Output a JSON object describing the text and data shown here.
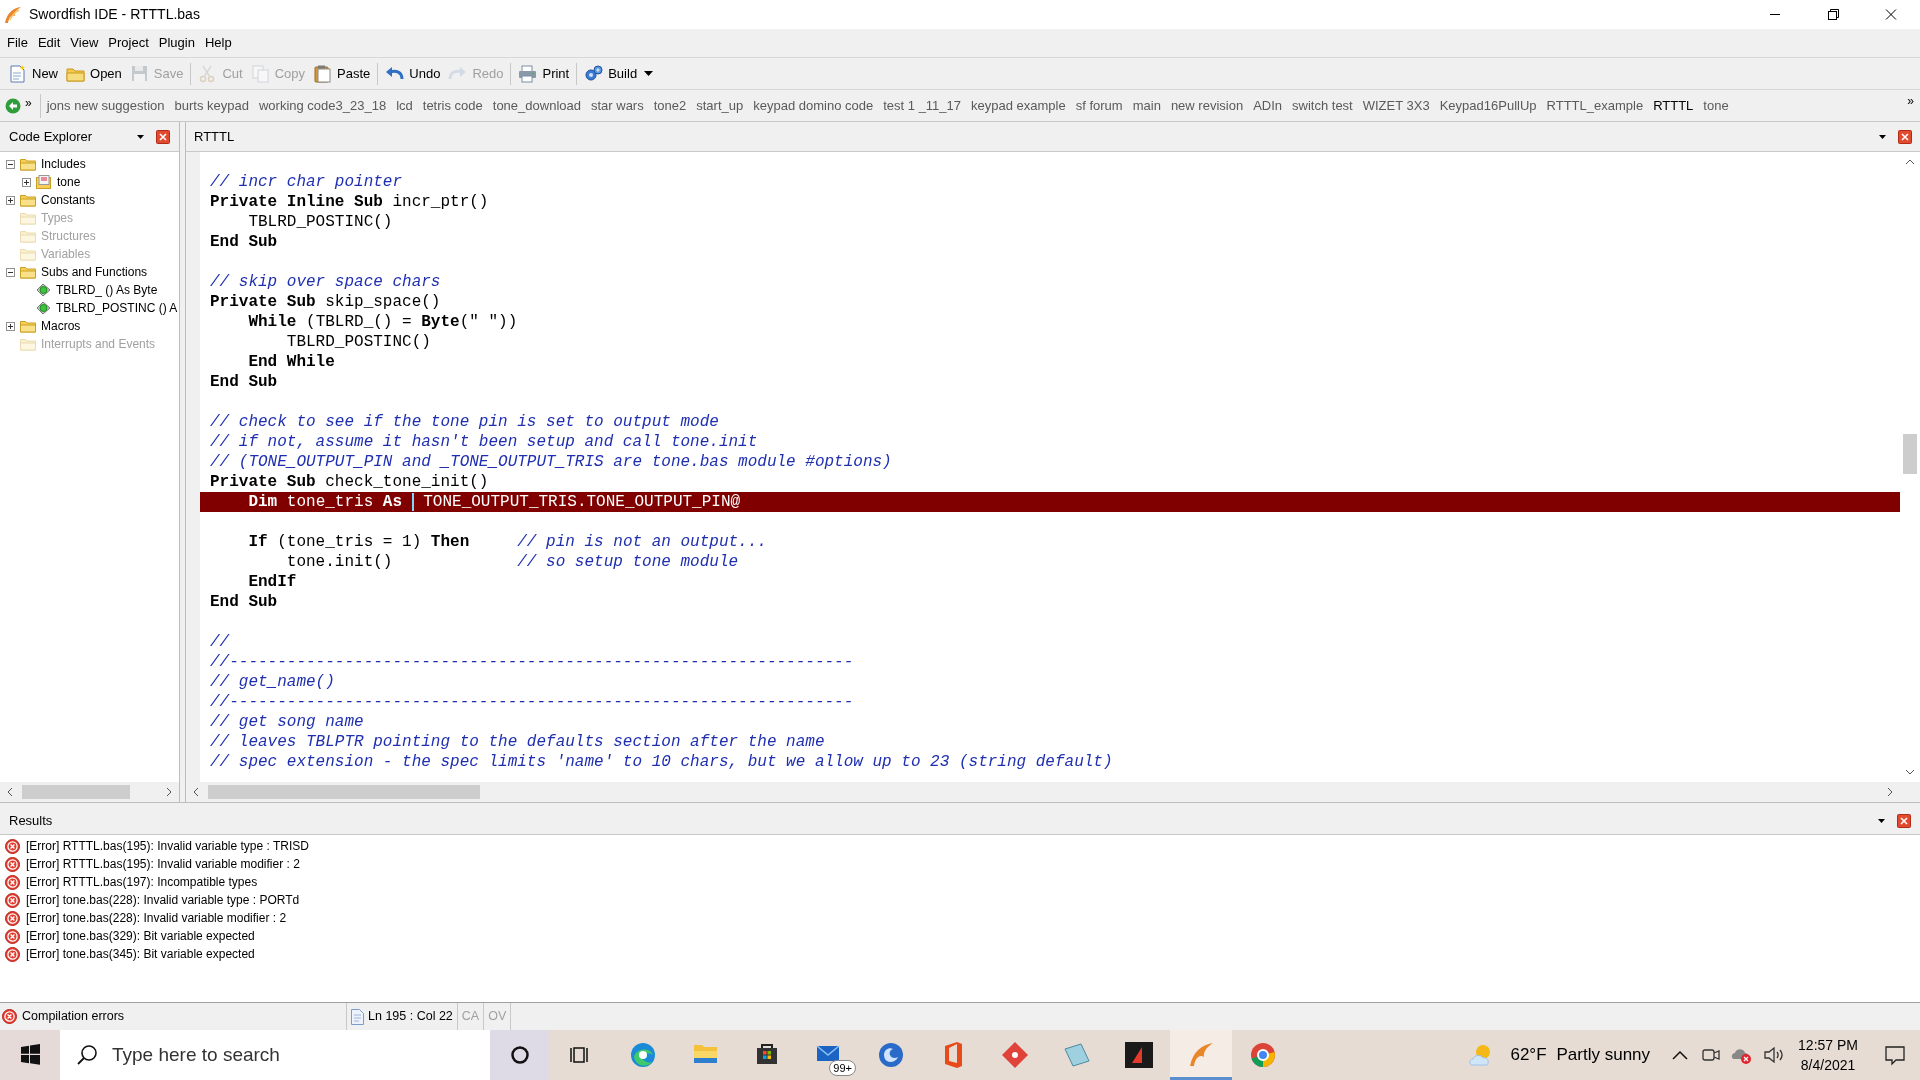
{
  "window": {
    "title": "Swordfish IDE - RTTTL.bas"
  },
  "menu": [
    "File",
    "Edit",
    "View",
    "Project",
    "Plugin",
    "Help"
  ],
  "toolbar": [
    [
      {
        "label": "New",
        "disabled": false
      },
      {
        "label": "Open",
        "disabled": false
      },
      {
        "label": "Save",
        "disabled": true
      }
    ],
    [
      {
        "label": "Cut",
        "disabled": true
      },
      {
        "label": "Copy",
        "disabled": true
      },
      {
        "label": "Paste",
        "disabled": false
      }
    ],
    [
      {
        "label": "Undo",
        "disabled": false
      },
      {
        "label": "Redo",
        "disabled": true
      }
    ],
    [
      {
        "label": "Print",
        "disabled": false
      }
    ],
    [
      {
        "label": "Build",
        "disabled": false,
        "dropdown": true
      }
    ]
  ],
  "file_tabs": {
    "overflow_left": "»",
    "overflow_right": "»",
    "tabs": [
      {
        "label": "jons new suggestion",
        "selected": false
      },
      {
        "label": "burts keypad",
        "selected": false
      },
      {
        "label": "working code3_23_18",
        "selected": false
      },
      {
        "label": "lcd",
        "selected": false
      },
      {
        "label": "tetris code",
        "selected": false
      },
      {
        "label": "tone_download",
        "selected": false
      },
      {
        "label": "star wars",
        "selected": false
      },
      {
        "label": "tone2",
        "selected": false
      },
      {
        "label": "start_up",
        "selected": false
      },
      {
        "label": "keypad domino code",
        "selected": false
      },
      {
        "label": "test 1 _11_17",
        "selected": false
      },
      {
        "label": "keypad example",
        "selected": false
      },
      {
        "label": "sf forum",
        "selected": false
      },
      {
        "label": "main",
        "selected": false
      },
      {
        "label": "new revision",
        "selected": false
      },
      {
        "label": "ADIn",
        "selected": false
      },
      {
        "label": "switch test",
        "selected": false
      },
      {
        "label": "WIZET 3X3",
        "selected": false
      },
      {
        "label": "Keypad16PullUp",
        "selected": false
      },
      {
        "label": "RTTTL_example",
        "selected": false
      },
      {
        "label": "RTTTL",
        "selected": true
      },
      {
        "label": "tone",
        "selected": false
      }
    ]
  },
  "code_explorer": {
    "title": "Code Explorer",
    "tree": [
      {
        "label": "Includes",
        "kind": "folder",
        "disabled": false,
        "expanded": true,
        "children": [
          {
            "label": "tone",
            "kind": "module",
            "disabled": false,
            "expanded": false
          }
        ]
      },
      {
        "label": "Constants",
        "kind": "folder",
        "disabled": false,
        "expanded": false
      },
      {
        "label": "Types",
        "kind": "folder",
        "disabled": true
      },
      {
        "label": "Structures",
        "kind": "folder",
        "disabled": true
      },
      {
        "label": "Variables",
        "kind": "folder",
        "disabled": true
      },
      {
        "label": "Subs and Functions",
        "kind": "folder",
        "disabled": false,
        "expanded": true,
        "children": [
          {
            "label": "TBLRD_ () As Byte",
            "kind": "sub",
            "disabled": false
          },
          {
            "label": "TBLRD_POSTINC () A",
            "kind": "sub",
            "disabled": false
          }
        ]
      },
      {
        "label": "Macros",
        "kind": "folder",
        "disabled": false,
        "expanded": false
      },
      {
        "label": "Interrupts and Events",
        "kind": "folder",
        "disabled": true
      }
    ]
  },
  "editor": {
    "tab": "RTTTL",
    "lines": [
      {
        "segments": [
          {
            "kind": "comment",
            "text": "// incr char pointer"
          }
        ]
      },
      {
        "segments": [
          {
            "kind": "keyword",
            "text": "Private Inline Sub"
          },
          {
            "kind": "plain",
            "text": " incr_ptr()"
          }
        ]
      },
      {
        "segments": [
          {
            "kind": "plain",
            "text": "    TBLRD_POSTINC()"
          }
        ]
      },
      {
        "segments": [
          {
            "kind": "keyword",
            "text": "End Sub"
          }
        ]
      },
      {
        "kind": "blank"
      },
      {
        "segments": [
          {
            "kind": "comment",
            "text": "// skip over space chars"
          }
        ]
      },
      {
        "segments": [
          {
            "kind": "keyword",
            "text": "Private Sub"
          },
          {
            "kind": "plain",
            "text": " skip_space()"
          }
        ]
      },
      {
        "segments": [
          {
            "kind": "keyword",
            "text": "    While"
          },
          {
            "kind": "plain",
            "text": " (TBLRD_() = "
          },
          {
            "kind": "keyword",
            "text": "Byte"
          },
          {
            "kind": "plain",
            "text": "(\" \"))"
          }
        ]
      },
      {
        "segments": [
          {
            "kind": "plain",
            "text": "        TBLRD_POSTINC()"
          }
        ]
      },
      {
        "segments": [
          {
            "kind": "keyword",
            "text": "    End While"
          }
        ]
      },
      {
        "segments": [
          {
            "kind": "keyword",
            "text": "End Sub"
          }
        ]
      },
      {
        "kind": "blank"
      },
      {
        "segments": [
          {
            "kind": "comment",
            "text": "// check to see if the tone pin is set to output mode"
          }
        ]
      },
      {
        "segments": [
          {
            "kind": "comment",
            "text": "// if not, assume it hasn't been setup and call tone.init"
          }
        ]
      },
      {
        "segments": [
          {
            "kind": "comment",
            "text": "// (TONE_OUTPUT_PIN and _TONE_OUTPUT_TRIS are tone.bas module #options)"
          }
        ]
      },
      {
        "segments": [
          {
            "kind": "keyword",
            "text": "Private Sub"
          },
          {
            "kind": "plain",
            "text": " check_tone_init()"
          }
        ]
      },
      {
        "highlighted": true,
        "segments": [
          {
            "kind": "keyword",
            "text": "    Dim"
          },
          {
            "kind": "plain",
            "text": " tone_tris "
          },
          {
            "kind": "keyword",
            "text": "As "
          },
          {
            "kind": "caret"
          },
          {
            "kind": "plain",
            "text": " TONE_OUTPUT_TRIS.TONE_OUTPUT_PIN@"
          }
        ]
      },
      {
        "kind": "blank"
      },
      {
        "segments": [
          {
            "kind": "keyword",
            "text": "    If"
          },
          {
            "kind": "plain",
            "text": " (tone_tris = 1) "
          },
          {
            "kind": "keyword",
            "text": "Then"
          },
          {
            "kind": "comment",
            "text": "     // pin is not an output..."
          }
        ]
      },
      {
        "segments": [
          {
            "kind": "plain",
            "text": "        tone.init()"
          },
          {
            "kind": "comment",
            "text": "             // so setup tone module"
          }
        ]
      },
      {
        "segments": [
          {
            "kind": "keyword",
            "text": "    EndIf"
          }
        ]
      },
      {
        "segments": [
          {
            "kind": "keyword",
            "text": "End Sub"
          }
        ]
      },
      {
        "kind": "blank"
      },
      {
        "segments": [
          {
            "kind": "comment",
            "text": "//"
          }
        ]
      },
      {
        "segments": [
          {
            "kind": "comment",
            "text": "//-----------------------------------------------------------------"
          }
        ]
      },
      {
        "segments": [
          {
            "kind": "comment",
            "text": "// get_name()"
          }
        ]
      },
      {
        "segments": [
          {
            "kind": "comment",
            "text": "//-----------------------------------------------------------------"
          }
        ]
      },
      {
        "segments": [
          {
            "kind": "comment",
            "text": "// get song name"
          }
        ]
      },
      {
        "segments": [
          {
            "kind": "comment",
            "text": "// leaves TBLPTR pointing to the defaults section after the name"
          }
        ]
      },
      {
        "segments": [
          {
            "kind": "comment",
            "text": "// spec extension - the spec limits 'name' to 10 chars, but we allow up to 23 (string default)"
          }
        ]
      }
    ]
  },
  "results": {
    "title": "Results",
    "messages": [
      "[Error] RTTTL.bas(195): Invalid variable type : TRISD",
      "[Error] RTTTL.bas(195): Invalid variable modifier : 2",
      "[Error] RTTTL.bas(197): Incompatible types",
      "[Error] tone.bas(228): Invalid variable type : PORTd",
      "[Error] tone.bas(228): Invalid variable modifier : 2",
      "[Error] tone.bas(329): Bit variable expected",
      "[Error] tone.bas(345): Bit variable expected"
    ]
  },
  "status_bar": {
    "message": "Compilation errors",
    "position": "Ln 195 : Col 22",
    "caps": "CA",
    "overwrite": "OV"
  },
  "taskbar": {
    "search": {
      "placeholder": "Type here to search"
    },
    "apps": [
      {
        "kind": "edge",
        "active": false
      },
      {
        "kind": "explorer",
        "active": false
      },
      {
        "kind": "store",
        "active": false
      },
      {
        "kind": "mail",
        "active": false,
        "badge": "99+"
      },
      {
        "kind": "blue-app",
        "active": false
      },
      {
        "kind": "office",
        "active": false
      },
      {
        "kind": "red-app",
        "active": false
      },
      {
        "kind": "tablet-app",
        "active": false
      },
      {
        "kind": "dark-app",
        "active": false
      },
      {
        "kind": "swordfish",
        "active": true
      },
      {
        "kind": "chrome",
        "active": false
      }
    ],
    "weather": {
      "temperature": "62°F",
      "condition": "Partly sunny"
    },
    "time": "12:57 PM",
    "date": "8/4/2021"
  }
}
